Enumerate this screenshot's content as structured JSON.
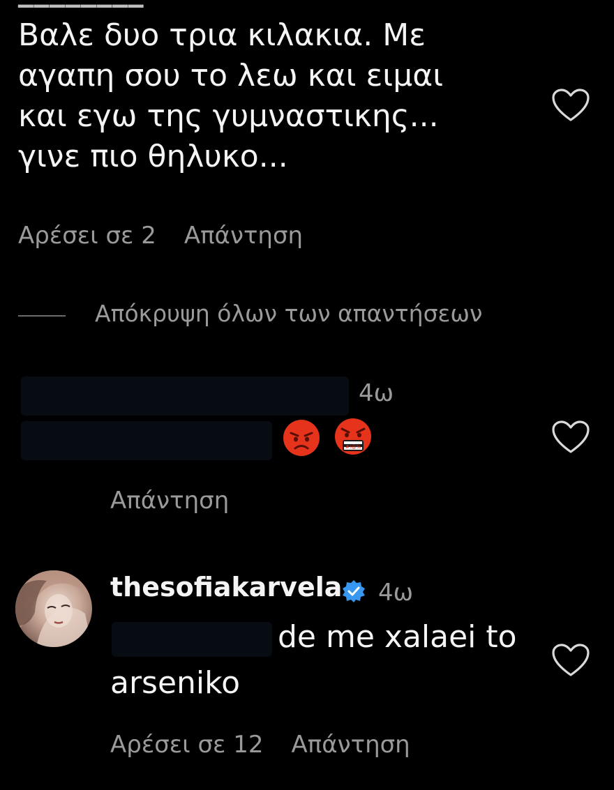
{
  "comment1": {
    "text": "Βαλε δυο τρια κιλακια. Με\nαγαπη σου το λεω και ειμαι\nκαι εγω της γυμναστικης...\nγινε πιο θηλυκο...",
    "likes_label": "Αρέσει σε 2",
    "reply_label": "Απάντηση",
    "heart_icon": "heart-outline-icon"
  },
  "hide_replies": {
    "label": "Απόκρυψη όλων των απαντήσεων"
  },
  "comment2": {
    "time": "4ω",
    "emojis": [
      "pouting-face",
      "face-with-symbols-on-mouth"
    ],
    "emoji_color": "#e5331c",
    "reply_label": "Απάντηση",
    "heart_icon": "heart-outline-icon"
  },
  "comment3": {
    "username": "thesofiakarvela",
    "verified": true,
    "verified_color": "#3897f0",
    "time": "4ω",
    "text_line1": "de me xalaei to",
    "text_line2": "arseniko",
    "likes_label": "Αρέσει σε 12",
    "reply_label": "Απάντηση",
    "heart_icon": "heart-outline-icon"
  }
}
